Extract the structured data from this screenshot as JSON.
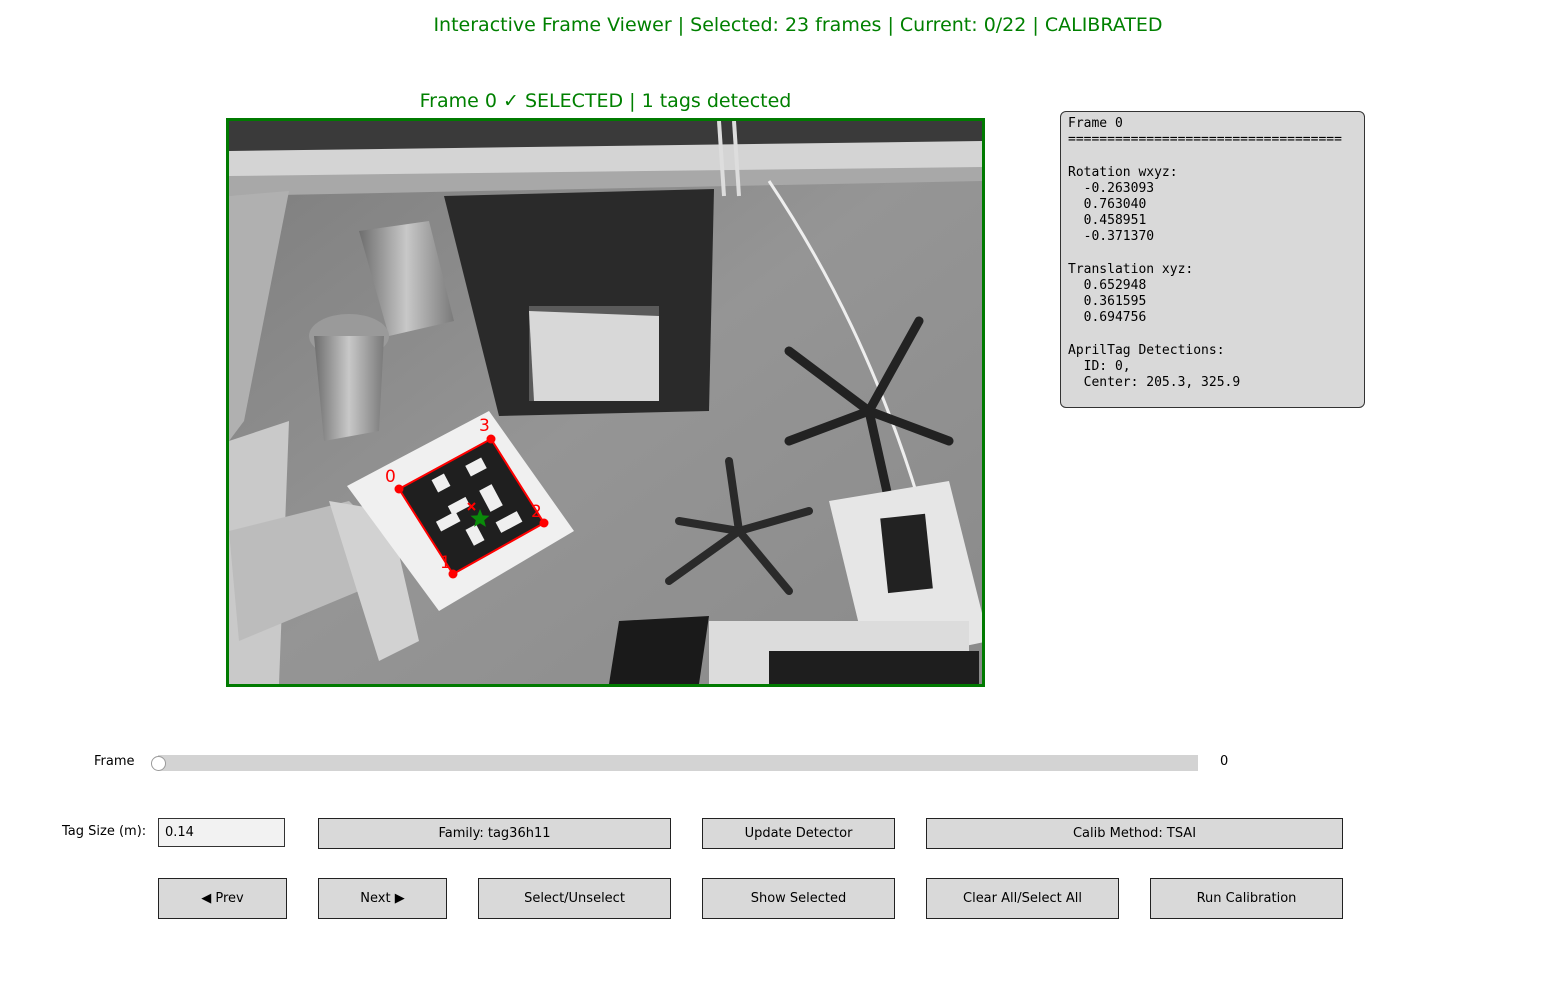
{
  "window_title": "Interactive Frame Viewer | Selected: 23 frames | Current: 0/22 | CALIBRATED",
  "frame_panel": {
    "title": "Frame 0 ✓ SELECTED | 1 tags detected",
    "border_color": "#007a00",
    "tag": {
      "corner_labels": [
        "0",
        "1",
        "2",
        "3"
      ],
      "corner_color": "#ff0000",
      "center_marker": "green-star",
      "origin_marker": "red-x"
    }
  },
  "info_box": {
    "text": "Frame 0\n===================================\n\nRotation wxyz:\n  -0.263093\n  0.763040\n  0.458951\n  -0.371370\n\nTranslation xyz:\n  0.652948\n  0.361595\n  0.694756\n\nAprilTag Detections:\n  ID: 0,\n  Center: 205.3, 325.9"
  },
  "slider": {
    "label": "Frame",
    "value": "0",
    "min": 0,
    "max": 22,
    "current": 0
  },
  "controls": {
    "tag_size_label": "Tag Size (m):",
    "tag_size_value": "0.14",
    "family_button": "Family: tag36h11",
    "update_detector_button": "Update Detector",
    "calib_method_button": "Calib Method: TSAI",
    "prev_button": "◀ Prev",
    "next_button": "Next ▶",
    "select_button": "Select/Unselect",
    "show_selected_button": "Show Selected",
    "clear_all_button": "Clear All/Select All",
    "run_calibration_button": "Run Calibration"
  },
  "colors": {
    "title_green": "#008000",
    "button_bg": "#d9d9d9",
    "info_bg": "#d9d9d9",
    "tag_outline": "#ff0000"
  }
}
